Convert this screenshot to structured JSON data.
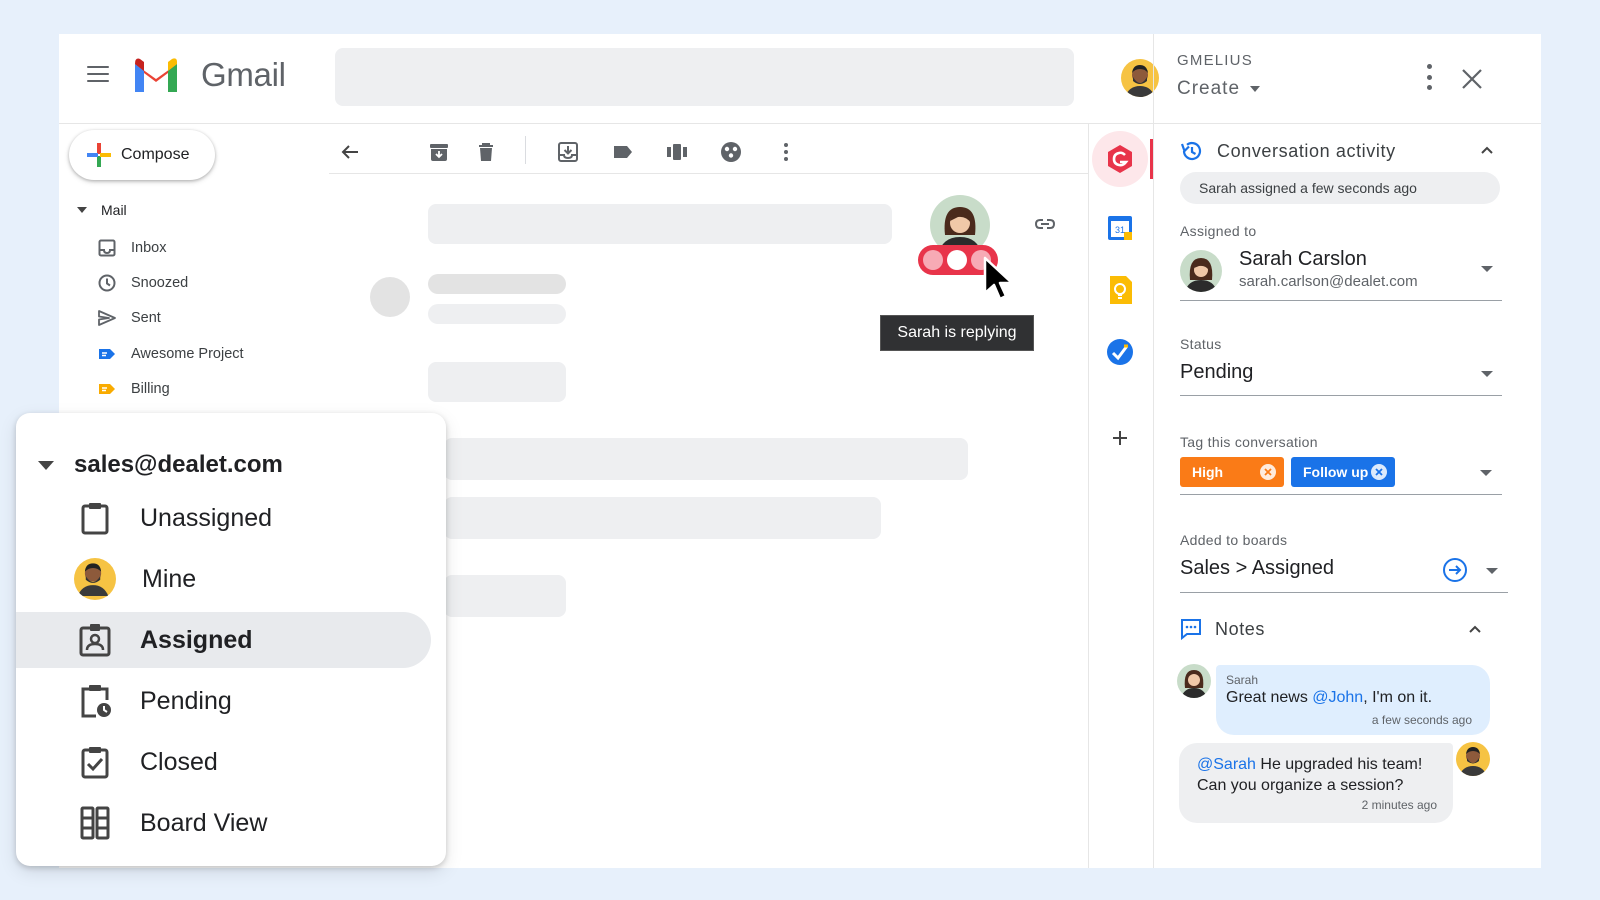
{
  "header": {
    "brand": "Gmail"
  },
  "compose": {
    "label": "Compose"
  },
  "mail_section": {
    "title": "Mail",
    "items": [
      {
        "label": "Inbox",
        "icon": "inbox-icon"
      },
      {
        "label": "Snoozed",
        "icon": "clock-icon"
      },
      {
        "label": "Sent",
        "icon": "send-icon"
      },
      {
        "label": "Awesome Project",
        "icon": "label-icon",
        "color": "#1a73e8"
      },
      {
        "label": "Billing",
        "icon": "label-icon",
        "color": "#f9ab00"
      }
    ]
  },
  "shared_inbox": {
    "account": "sales@dealet.com",
    "items": [
      {
        "label": "Unassigned",
        "icon": "clipboard-icon"
      },
      {
        "label": "Mine",
        "icon": "avatar"
      },
      {
        "label": "Assigned",
        "icon": "assigned-badge-icon",
        "active": true
      },
      {
        "label": "Pending",
        "icon": "pending-clipboard-icon"
      },
      {
        "label": "Closed",
        "icon": "checked-clipboard-icon"
      },
      {
        "label": "Board View",
        "icon": "board-icon"
      }
    ]
  },
  "thread": {
    "tooltip": "Sarah is replying"
  },
  "panel": {
    "brand": "GMELIUS",
    "create_label": "Create",
    "activity": {
      "title": "Conversation activity",
      "info": "Sarah assigned a few seconds ago",
      "assigned_label": "Assigned to",
      "assignee_name": "Sarah Carslon",
      "assignee_email": "sarah.carlson@dealet.com",
      "status_label": "Status",
      "status_value": "Pending",
      "tags_label": "Tag this conversation",
      "tags": [
        {
          "label": "High",
          "color": "#fa7b17"
        },
        {
          "label": "Follow up",
          "color": "#1a73e8"
        }
      ],
      "boards_label": "Added to boards",
      "boards_value": "Sales > Assigned"
    },
    "notes": {
      "title": "Notes",
      "items": [
        {
          "author": "Sarah",
          "mention": "@John",
          "text_before": "Great news ",
          "text_after": ", I'm on it.",
          "time": "a few seconds ago"
        },
        {
          "mention": "@Sarah",
          "text_line1": " He upgraded his team!",
          "text_line2": "Can you organize a session?",
          "time": "2 minutes ago"
        }
      ]
    }
  },
  "colors": {
    "accent": "#e8344a",
    "background": "#e7f0fb",
    "blue": "#1a73e8"
  }
}
